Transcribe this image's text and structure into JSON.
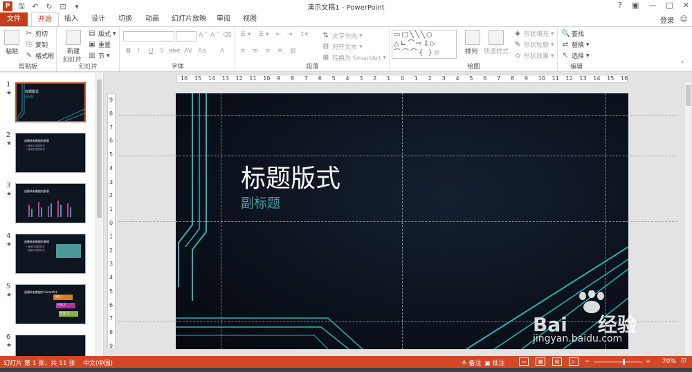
{
  "window": {
    "title": "演示文稿1 - PowerPoint",
    "help": "?",
    "restore": "▣",
    "minimize": "—",
    "maximize": "□",
    "close": "✕"
  },
  "tabs": {
    "file": "文件",
    "items": [
      "开始",
      "插入",
      "设计",
      "切换",
      "动画",
      "幻灯片放映",
      "审阅",
      "视图"
    ],
    "login": "登录"
  },
  "ribbon": {
    "clipboard": {
      "label": "剪贴板",
      "paste": "粘贴",
      "cut": "剪切",
      "copy": "复制",
      "format_painter": "格式刷"
    },
    "slides": {
      "label": "幻灯片",
      "new_slide": "新建",
      "new_slide2": "幻灯片",
      "layout": "版式",
      "reset": "重置",
      "section": "节"
    },
    "font": {
      "label": "字体",
      "bold": "B",
      "italic": "I",
      "underline": "U",
      "shadow": "S",
      "strike": "abc",
      "spacing": "AV",
      "case": "Aa",
      "color": "A",
      "grow": "A",
      "shrink": "A"
    },
    "paragraph": {
      "label": "段落",
      "text_direction": "文字方向",
      "align_text": "对齐文本",
      "smartart": "转换为 SmartArt"
    },
    "drawing": {
      "label": "绘图",
      "arrange": "排列",
      "quick_styles": "快速样式",
      "shape_fill": "形状填充",
      "shape_outline": "形状轮廓",
      "shape_effects": "形状效果"
    },
    "editing": {
      "label": "编辑",
      "find": "查找",
      "replace": "替换",
      "select": "选择"
    }
  },
  "thumbnails": [
    {
      "num": "1",
      "star": "★",
      "title": "标题版式",
      "sub": "副标题",
      "selected": true
    },
    {
      "num": "2",
      "star": "★",
      "title": "创建具有数据的图表",
      "lines": [
        "• 使用文本框形式",
        "• 使用文本框形式"
      ]
    },
    {
      "num": "3",
      "star": "★",
      "title": "创建具有数据的图表"
    },
    {
      "num": "4",
      "star": "★",
      "title": "创建具有数据的表格",
      "lines": [
        "• 使用文本框形式",
        "• 使用文本框形式"
      ]
    },
    {
      "num": "5",
      "star": "★",
      "title": "创建具有数据的 SmartArt",
      "lines": [
        "任务 1",
        "任务 2",
        "任务 3"
      ]
    },
    {
      "num": "6",
      "star": "★",
      "title": ""
    }
  ],
  "ruler": {
    "horizontal": [
      "16",
      "15",
      "14",
      "13",
      "12",
      "11",
      "10",
      "9",
      "8",
      "7",
      "6",
      "5",
      "4",
      "3",
      "2",
      "1",
      "0",
      "1",
      "2",
      "3",
      "4",
      "5",
      "6",
      "7",
      "8",
      "9",
      "10",
      "11",
      "12",
      "13",
      "14",
      "15",
      "16"
    ],
    "vertical": [
      "9",
      "8",
      "7",
      "6",
      "5",
      "4",
      "3",
      "2",
      "1",
      "0",
      "1",
      "2",
      "3",
      "4",
      "5",
      "6",
      "7",
      "8",
      "9"
    ]
  },
  "slide": {
    "title": "标题版式",
    "subtitle": "副标题"
  },
  "status": {
    "slide_info": "幻灯片 第 1 张，共 11 张",
    "language": "中文(中国)",
    "notes": "备注",
    "comments": "批注",
    "zoom": "70%",
    "zoom_level": 0.7
  },
  "watermark": {
    "brand": "Bai",
    "brand2": "经验",
    "url": "jingyan.baidu.com"
  },
  "colors": {
    "accent": "#d24726",
    "file_tab": "#c43e1c",
    "teal": "#3aa3a3",
    "slide_bg": "#0a0f18"
  }
}
